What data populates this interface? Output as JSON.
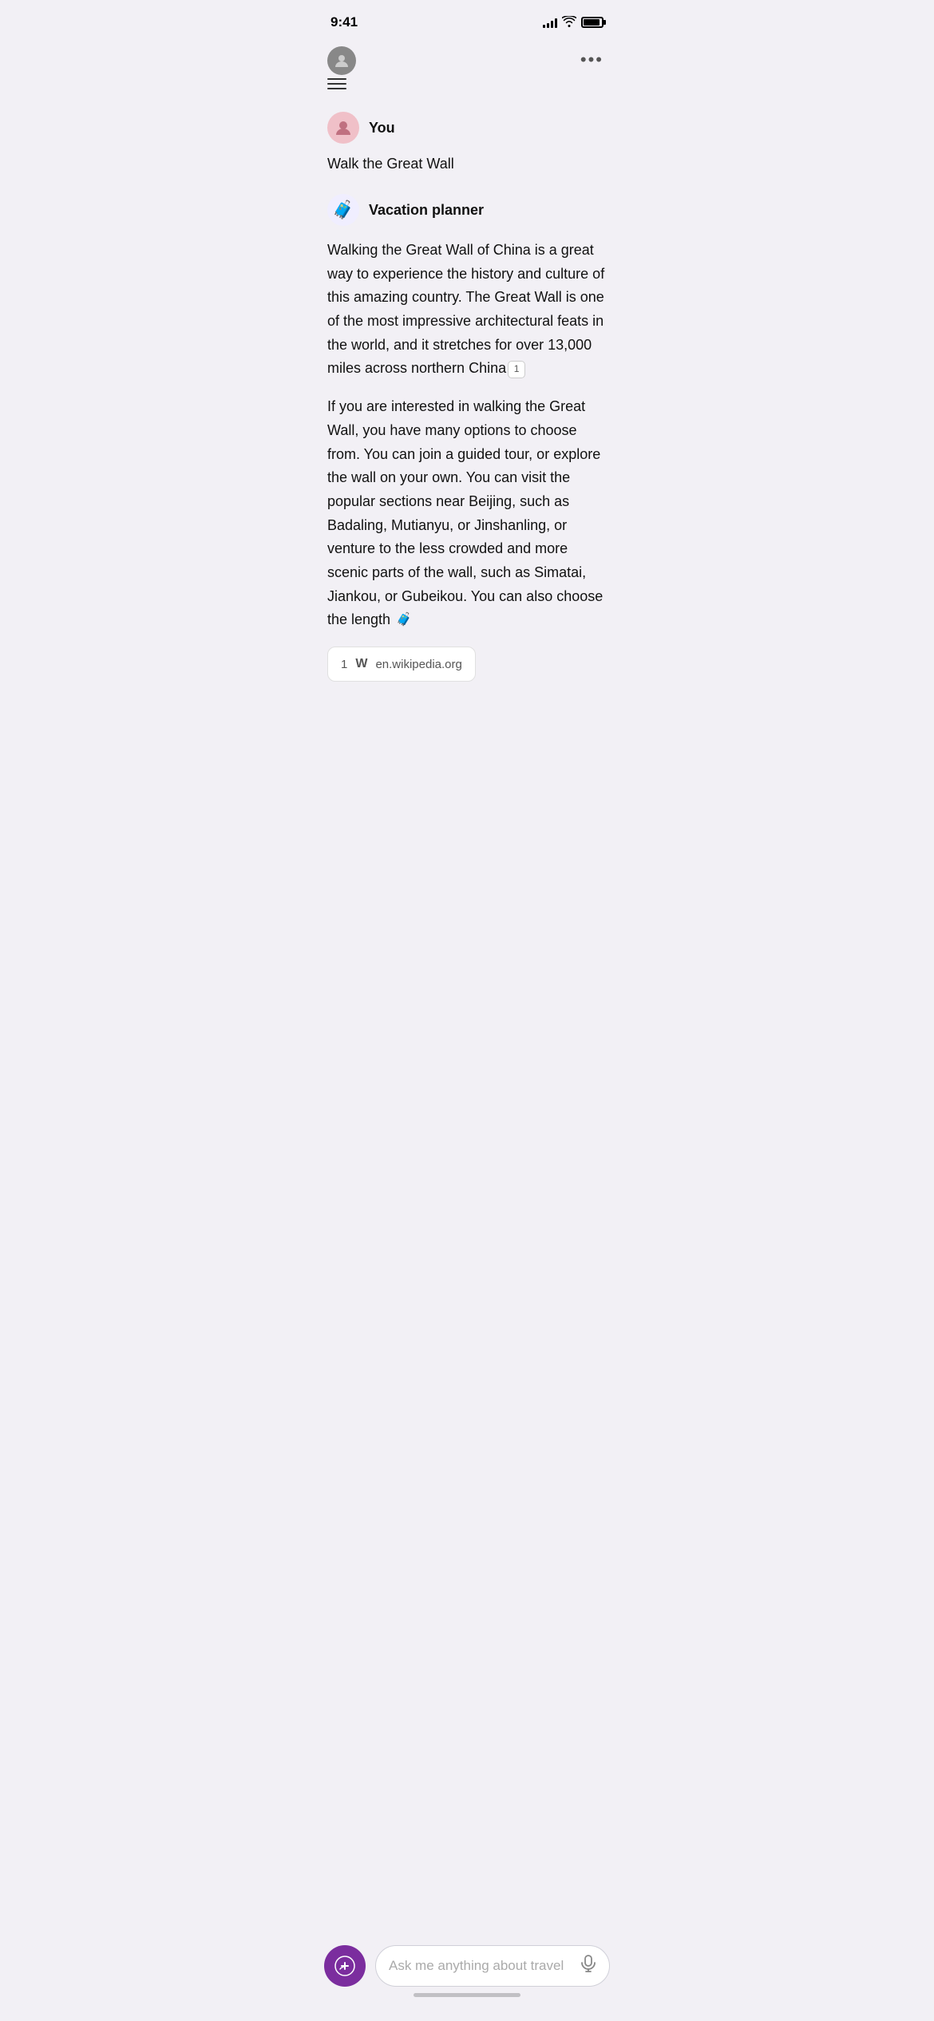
{
  "statusBar": {
    "time": "9:41",
    "signalBars": [
      4,
      6,
      8,
      10,
      12
    ],
    "wifiLabel": "wifi",
    "batteryLabel": "battery"
  },
  "header": {
    "moreDotsLabel": "•••"
  },
  "userMessage": {
    "userName": "You",
    "userText": "Walk the Great Wall"
  },
  "aiMessage": {
    "botName": "Vacation planner",
    "paragraph1": "Walking the Great Wall of China is a great way to experience the history and culture of this amazing country. The Great Wall is one of the most impressive architectural feats in the world, and it stretches for over 13,000 miles across northern China",
    "footnote1": "1",
    "paragraph2": "If you are interested in walking the Great Wall, you have many options to choose from. You can join a guided tour, or explore the wall on your own. You can visit the popular sections near Beijing, such as Badaling, Mutianyu, or Jinshanling, or venture to the less crowded and more scenic parts of the wall, such as Simatai, Jiankou, or Gubeikou. You can also choose the length"
  },
  "citation": {
    "number": "1",
    "wikiSymbol": "W",
    "url": "en.wikipedia.org"
  },
  "inputBar": {
    "placeholder": "Ask me anything about travel"
  }
}
